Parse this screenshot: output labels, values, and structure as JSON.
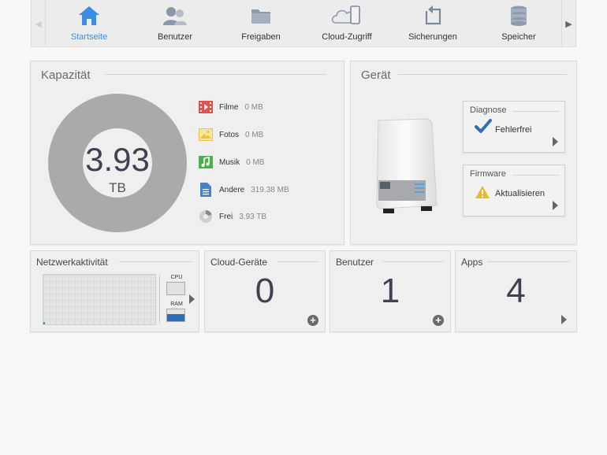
{
  "nav": {
    "items": [
      {
        "label": "Startseite",
        "icon": "home-icon",
        "active": true
      },
      {
        "label": "Benutzer",
        "icon": "users-icon",
        "active": false
      },
      {
        "label": "Freigaben",
        "icon": "folder-icon",
        "active": false
      },
      {
        "label": "Cloud-Zugriff",
        "icon": "cloud-device-icon",
        "active": false
      },
      {
        "label": "Sicherungen",
        "icon": "backup-icon",
        "active": false
      },
      {
        "label": "Speicher",
        "icon": "storage-icon",
        "active": false
      }
    ]
  },
  "capacity": {
    "title": "Kapazität",
    "total_value": "3.93",
    "total_unit": "TB",
    "legend": [
      {
        "name": "Filme",
        "value": "0 MB",
        "icon": "film-icon"
      },
      {
        "name": "Fotos",
        "value": "0 MB",
        "icon": "photo-icon"
      },
      {
        "name": "Musik",
        "value": "0 MB",
        "icon": "music-icon"
      },
      {
        "name": "Andere",
        "value": "319.38 MB",
        "icon": "document-icon"
      },
      {
        "name": "Frei",
        "value": "3.93 TB",
        "icon": "pie-icon"
      }
    ]
  },
  "device": {
    "title": "Gerät",
    "diagnose": {
      "title": "Diagnose",
      "value": "Fehlerfrei"
    },
    "firmware": {
      "title": "Firmware",
      "value": "Aktualisieren"
    }
  },
  "network": {
    "title": "Netzwerkaktivität",
    "cpu_label": "CPU",
    "ram_label": "RAM"
  },
  "cloud_devices": {
    "title": "Cloud-Geräte",
    "count": "0"
  },
  "users": {
    "title": "Benutzer",
    "count": "1"
  },
  "apps": {
    "title": "Apps",
    "count": "4"
  },
  "colors": {
    "accent": "#3a8ee6",
    "donut": "#a9aaaa",
    "film": "#d9534f",
    "photo": "#e8c53a",
    "music": "#4cae4c",
    "document": "#4a7fc1",
    "check": "#2f6db5",
    "warning": "#e6b92e"
  }
}
